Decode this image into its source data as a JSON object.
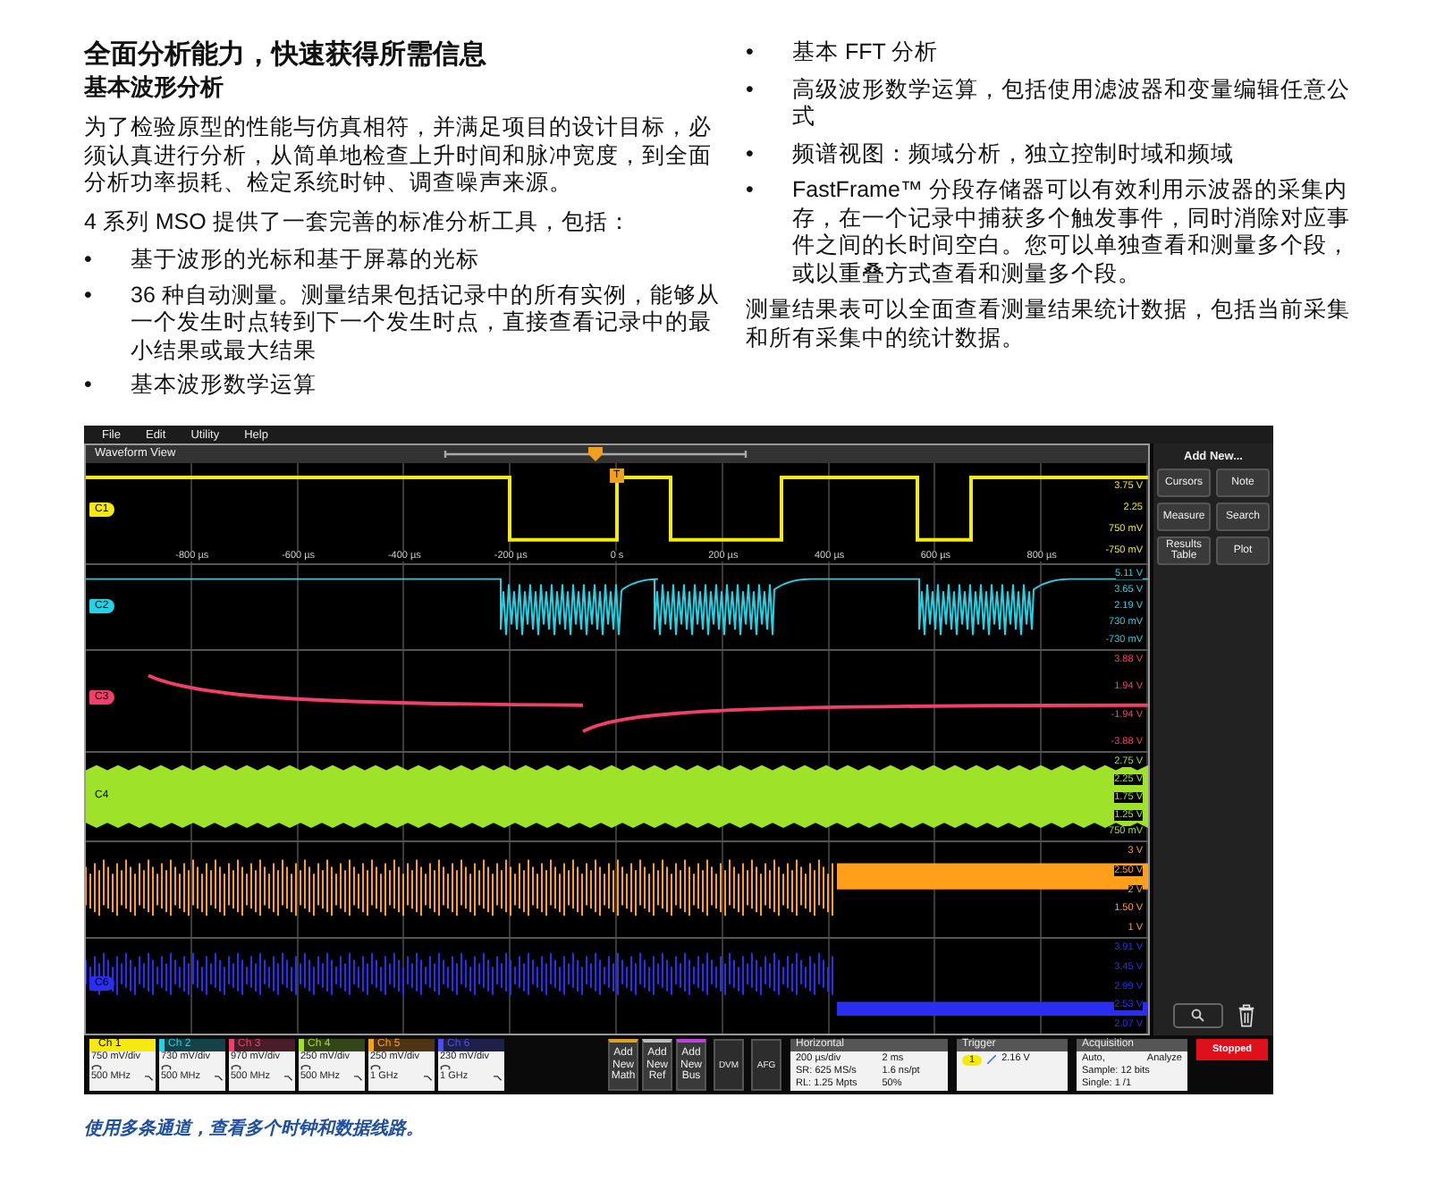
{
  "article": {
    "title": "全面分析能力，快速获得所需信息",
    "subtitle": "基本波形分析",
    "intro": "为了检验原型的性能与仿真相符，并满足项目的设计目标，必须认真进行分析，从简单地检查上升时间和脉冲宽度，到全面分析功率损耗、检定系统时钟、调查噪声来源。",
    "lead": "4 系列 MSO 提供了一套完善的标准分析工具，包括：",
    "left_bullets": [
      {
        "marker": "•",
        "text": "基于波形的光标和基于屏幕的光标"
      },
      {
        "marker": "•",
        "text": "36 种自动测量。测量结果包括记录中的所有实例，能够从一个发生时点转到下一个发生时点，直接查看记录中的最小结果或最大结果"
      },
      {
        "marker": "•",
        "text": "基本波形数学运算"
      }
    ],
    "right_bullets": [
      {
        "marker": "•",
        "text": "基本 FFT 分析"
      },
      {
        "marker": "•",
        "text": "高级波形数学运算，包括使用滤波器和变量编辑任意公式"
      },
      {
        "marker": "•",
        "text": "频谱视图：频域分析，独立控制时域和频域"
      },
      {
        "marker": "•",
        "text": "FastFrame™ 分段存储器可以有效利用示波器的采集内存，在一个记录中捕获多个触发事件，同时消除对应事件之间的长时间空白。您可以单独查看和测量多个段，或以重叠方式查看和测量多个段。"
      }
    ],
    "closing": "测量结果表可以全面查看测量结果统计数据，包括当前采集和所有采集中的统计数据。"
  },
  "scope": {
    "menu": [
      "File",
      "Edit",
      "Utility",
      "Help"
    ],
    "view_title": "Waveform View",
    "trigger_marker": "T",
    "time_axis": [
      "-800 µs",
      "-600 µs",
      "-400 µs",
      "-200 µs",
      "0 s",
      "200 µs",
      "400 µs",
      "600 µs",
      "800 µs"
    ],
    "channels": [
      {
        "kind": "square",
        "marker": "C1",
        "color": "#f5e90f",
        "scale": [
          "3.75 V",
          "2.25",
          "750 mV",
          "-750 mV"
        ]
      },
      {
        "kind": "burst",
        "marker": "C2",
        "color": "#22d3e6",
        "scale": [
          "5.11 V",
          "3.65 V",
          "2.19 V",
          "730 mV",
          "-730 mV"
        ]
      },
      {
        "kind": "decay",
        "marker": "C3",
        "color": "#f0406a",
        "scale": [
          "3.88 V",
          "1.94 V",
          "-1.94 V",
          "-3.88 V"
        ]
      },
      {
        "kind": "band",
        "marker": "C4",
        "color": "#9ee22a",
        "scale": [
          "2.75 V",
          "2.25 V",
          "1.75 V",
          "1.25 V",
          "750 mV"
        ]
      },
      {
        "kind": "digital",
        "color": "#ff9f1a",
        "scale": [
          "3 V",
          "2.50 V",
          "2 V",
          "1.50 V",
          "1 V"
        ]
      },
      {
        "kind": "digital",
        "marker": "C6",
        "color": "#2a2ef0",
        "scale": [
          "3.91 V",
          "3.45 V",
          "2.99 V",
          "2.53 V",
          "2.07 V"
        ]
      }
    ],
    "side_panel": {
      "title": "Add New...",
      "buttons": [
        "Cursors",
        "Note",
        "Measure",
        "Search",
        "Results Table",
        "Plot"
      ]
    },
    "channel_badges": [
      {
        "label": "Ch 1",
        "scale": "750 mV/div",
        "bandwidth": "500 MHz",
        "color": "#f5e90f",
        "selected": true
      },
      {
        "label": "Ch 2",
        "scale": "730 mV/div",
        "bandwidth": "500 MHz",
        "color": "#22d3e6",
        "selected": false
      },
      {
        "label": "Ch 3",
        "scale": "970 mV/div",
        "bandwidth": "500 MHz",
        "color": "#f0406a",
        "selected": false
      },
      {
        "label": "Ch 4",
        "scale": "250 mV/div",
        "bandwidth": "500 MHz",
        "color": "#9ee22a",
        "selected": false
      },
      {
        "label": "Ch 5",
        "scale": "250 mV/div",
        "bandwidth": "1 GHz",
        "color": "#ff9f1a",
        "selected": false
      },
      {
        "label": "Ch 6",
        "scale": "230 mV/div",
        "bandwidth": "1 GHz",
        "color": "#4a4ef5",
        "selected": false
      }
    ],
    "add_buttons": [
      {
        "label": "Add New Math",
        "color": "#e0a020"
      },
      {
        "label": "Add New Ref",
        "color": "#bbbbbb"
      },
      {
        "label": "Add New Bus",
        "color": "#c040e0"
      }
    ],
    "tool_buttons": [
      "DVM",
      "AFG"
    ],
    "horizontal": {
      "title": "Horizontal",
      "values": [
        "200 µs/div",
        "2 ms",
        "SR: 625 MS/s",
        "1.6 ns/pt",
        "RL: 1.25 Mpts",
        "50%"
      ]
    },
    "trigger": {
      "title": "Trigger",
      "source": "1",
      "level": "2.16 V"
    },
    "acquisition": {
      "title": "Acquisition",
      "mode": "Auto,",
      "action": "Analyze",
      "lines": [
        "Sample: 12 bits",
        "Single: 1 /1"
      ]
    },
    "run_state": "Stopped"
  },
  "caption": "使用多条通道，查看多个时钟和数据线路。"
}
